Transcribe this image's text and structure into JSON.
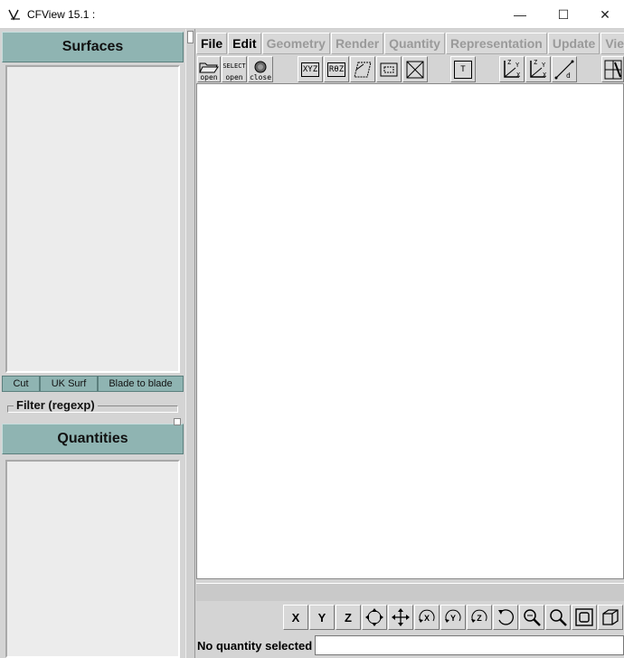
{
  "window": {
    "title": "CFView 15.1 :",
    "minimize_glyph": "—",
    "maximize_glyph": "☐",
    "close_glyph": "✕"
  },
  "left_panel": {
    "surfaces_title": "Surfaces",
    "quantities_title": "Quantities",
    "surface_tabs": [
      "Cut",
      "UK Surf",
      "Blade to blade"
    ],
    "filter_label": "Filter (regexp)"
  },
  "menubar": {
    "items": [
      {
        "label": "File",
        "enabled": true
      },
      {
        "label": "Edit",
        "enabled": true
      },
      {
        "label": "Geometry",
        "enabled": false
      },
      {
        "label": "Render",
        "enabled": false
      },
      {
        "label": "Quantity",
        "enabled": false
      },
      {
        "label": "Representation",
        "enabled": false
      },
      {
        "label": "Update",
        "enabled": false
      },
      {
        "label": "View",
        "enabled": false
      }
    ]
  },
  "toolbar": {
    "open_label": "open",
    "select_label": "SELECT",
    "select_open_label": "open",
    "close_label": "close",
    "xyz_label": "XYZ",
    "rbz_label": "RθZ",
    "t_label": "T",
    "axis_z": "Z",
    "axis_y": "Y",
    "axis_x": "X",
    "dist_label": "d"
  },
  "view_toolbar": {
    "x_label": "X",
    "y_label": "Y",
    "z_label": "Z"
  },
  "status": {
    "text": "No quantity selected"
  }
}
